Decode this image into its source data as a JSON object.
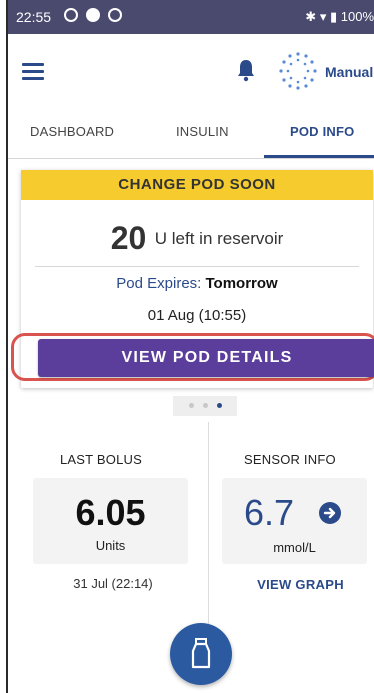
{
  "status_bar": {
    "time": "22:55",
    "battery": "100%",
    "background": "#4a4a6e"
  },
  "header": {
    "menu_icon": "hamburger-menu-icon",
    "notification_icon": "bell-icon",
    "mode_icon": "mode-dots-icon",
    "mode_label": "Manual"
  },
  "tabs": [
    {
      "label": "DASHBOARD",
      "active": false
    },
    {
      "label": "INSULIN",
      "active": false
    },
    {
      "label": "POD INFO",
      "active": true
    }
  ],
  "pod_card": {
    "banner": "CHANGE POD SOON",
    "banner_color": "#f6cb2d",
    "reservoir_units": "20",
    "reservoir_text": "U left in reservoir",
    "expires_label": "Pod Expires:",
    "expires_value": "Tomorrow",
    "expires_date": "01 Aug (10:55)",
    "details_button": "VIEW POD DETAILS",
    "button_color": "#5b3d9c"
  },
  "pager": {
    "pages": 3,
    "active_index": 2
  },
  "last_bolus": {
    "title": "LAST BOLUS",
    "value": "6.05",
    "unit": "Units",
    "timestamp": "31 Jul (22:14)"
  },
  "sensor_info": {
    "title": "SENSOR INFO",
    "value": "6.7",
    "unit": "mmol/L",
    "trend_icon": "arrow-right-circle-icon",
    "graph_link": "VIEW GRAPH"
  },
  "fab": {
    "icon": "pod-icon"
  },
  "colors": {
    "primary": "#2b4a8a",
    "highlight": "#d9534f"
  }
}
